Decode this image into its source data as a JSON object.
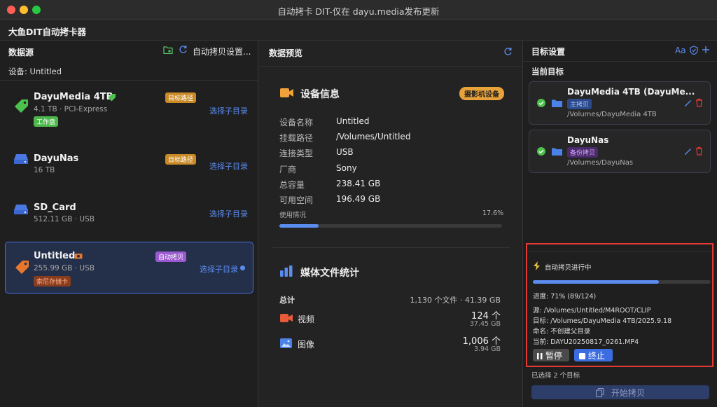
{
  "window": {
    "title": "自动拷卡 DIT-仅在 dayu.media发布更新"
  },
  "app": {
    "title": "大鱼DIT自动拷卡器"
  },
  "left": {
    "header": "数据源",
    "action_label": "自动拷贝设置...",
    "device_label": "设备: Untitled",
    "devices": [
      {
        "name": "DayuMedia 4TB",
        "sub": "4.1 TB  · PCI-Express",
        "badge": "目标路径",
        "tag": "工作盘",
        "pick": "选择子目录",
        "icon": "tag-icon"
      },
      {
        "name": "DayuNas",
        "sub": "16 TB",
        "badge": "目标路径",
        "pick": "选择子目录",
        "icon": "drive-icon"
      },
      {
        "name": "SD_Card",
        "sub": "512.11 GB  · USB",
        "pick": "选择子目录",
        "icon": "drive-icon"
      },
      {
        "name": "Untitled",
        "sub": "255.99 GB  · USB",
        "badge": "自动拷贝",
        "tag": "索尼存储卡",
        "pick": "选择子目录",
        "icon": "tag-icon"
      }
    ]
  },
  "middle": {
    "header": "数据预览",
    "device_info": {
      "title": "设备信息",
      "badge": "摄影机设备",
      "rows": [
        {
          "k": "设备名称",
          "v": "Untitled"
        },
        {
          "k": "挂载路径",
          "v": "/Volumes/Untitled"
        },
        {
          "k": "连接类型",
          "v": "USB"
        },
        {
          "k": "厂商",
          "v": "Sony"
        },
        {
          "k": "总容量",
          "v": "238.41 GB"
        },
        {
          "k": "可用空间",
          "v": "196.49 GB"
        }
      ],
      "usage_label": "使用情况",
      "usage_pct": "17.6%",
      "usage_fraction": 0.176
    },
    "media": {
      "title": "媒体文件统计",
      "total_label": "总计",
      "total_value": "1,130 个文件 · 41.39 GB",
      "video_label": "视频",
      "video_count": "124 个",
      "video_size": "37.45 GB",
      "image_label": "图像",
      "image_count": "1,006 个",
      "image_size": "3.94 GB"
    }
  },
  "right": {
    "header": "目标设置",
    "font_btn": "Aa",
    "current_label": "当前目标",
    "targets": [
      {
        "name": "DayuMedia 4TB (DayuMe...",
        "tag": "主拷贝",
        "path": "/Volumes/DayuMedia 4TB"
      },
      {
        "name": "DayuNas",
        "tag": "备份拷贝",
        "path": "/Volumes/DayuNas"
      }
    ],
    "progress": {
      "title": "自动拷贝进行中",
      "fraction": 0.71,
      "progress_text": "进度: 71%  (89/124)",
      "source": "源: /Volumes/Untitled/M4ROOT/CLIP",
      "target": "目标: /Volumes/DayuMedia 4TB/2025.9.18",
      "naming": "命名: 不创建父目录",
      "current": "当前: DAYU20250817_0261.MP4",
      "pause": "暂停",
      "stop": "终止"
    },
    "selected": "已选择 2 个目标",
    "start": "开始拷贝"
  },
  "colors": {
    "accent": "#5b8cf0",
    "orange": "#e8923a",
    "purple": "#9b59d0",
    "green": "#4cc24c",
    "red": "#e53935"
  }
}
